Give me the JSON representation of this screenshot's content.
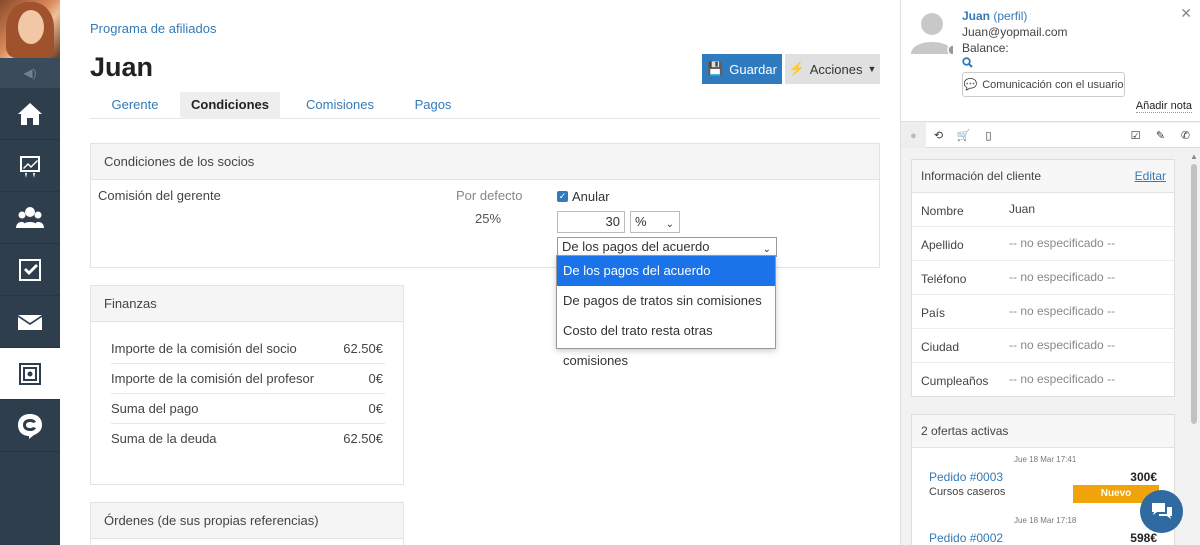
{
  "sidebar": {
    "items": [
      {
        "icon": "home-icon"
      },
      {
        "icon": "chart-icon"
      },
      {
        "icon": "users-icon"
      },
      {
        "icon": "checkbox-icon"
      },
      {
        "icon": "mail-icon"
      },
      {
        "icon": "safe-icon"
      },
      {
        "icon": "c-logo-icon"
      }
    ],
    "active_index": 5
  },
  "main": {
    "breadcrumb": "Programa de afiliados",
    "title": "Juan",
    "save_label": "Guardar",
    "actions_label": "Acciones",
    "tabs": [
      {
        "label": "Gerente"
      },
      {
        "label": "Condiciones",
        "active": true
      },
      {
        "label": "Comisiones"
      },
      {
        "label": "Pagos"
      }
    ],
    "conditions": {
      "header": "Condiciones de los socios",
      "label": "Comisión del gerente",
      "default_label": "Por defecto",
      "default_value": "25%",
      "override_label": "Anular",
      "override_checked": true,
      "amount": "30",
      "unit": "%",
      "source_selected": "De los pagos del acuerdo",
      "source_options": [
        "De los pagos del acuerdo",
        "De pagos de tratos sin comisiones",
        "Costo del trato resta otras comisiones"
      ]
    },
    "finances": {
      "header": "Finanzas",
      "rows": [
        {
          "label": "Importe de la comisión del socio",
          "value": "62.50€"
        },
        {
          "label": "Importe de la comisión del profesor",
          "value": "0€"
        },
        {
          "label": "Suma del pago",
          "value": "0€"
        },
        {
          "label": "Suma de la deuda",
          "value": "62.50€"
        }
      ]
    },
    "orders": {
      "header": "Órdenes (de sus propias referencias)"
    }
  },
  "right": {
    "name": "Juan",
    "profile_link": "(perfil)",
    "email": "Juan@yopmail.com",
    "balance_label": "Balance:",
    "comm_button": "Comunicación con el usuario",
    "add_note": "Añadir nota",
    "client_info": {
      "header": "Información del cliente",
      "edit": "Editar",
      "rows": [
        {
          "label": "Nombre",
          "value": "Juan"
        },
        {
          "label": "Apellido",
          "value": "-- no especificado --"
        },
        {
          "label": "Teléfono",
          "value": "-- no especificado --"
        },
        {
          "label": "País",
          "value": "-- no especificado --"
        },
        {
          "label": "Ciudad",
          "value": "-- no especificado --"
        },
        {
          "label": "Cumpleaños",
          "value": "-- no especificado --"
        }
      ]
    },
    "offers": {
      "header": "2 ofertas activas",
      "items": [
        {
          "date": "Jue 18 Mar 17:41",
          "number": "Pedido #0003",
          "price": "300€",
          "product": "Cursos caseros",
          "status": "Nuevo"
        },
        {
          "date": "Jue 18 Mar 17:18",
          "number": "Pedido #0002",
          "price": "598€"
        }
      ]
    }
  }
}
